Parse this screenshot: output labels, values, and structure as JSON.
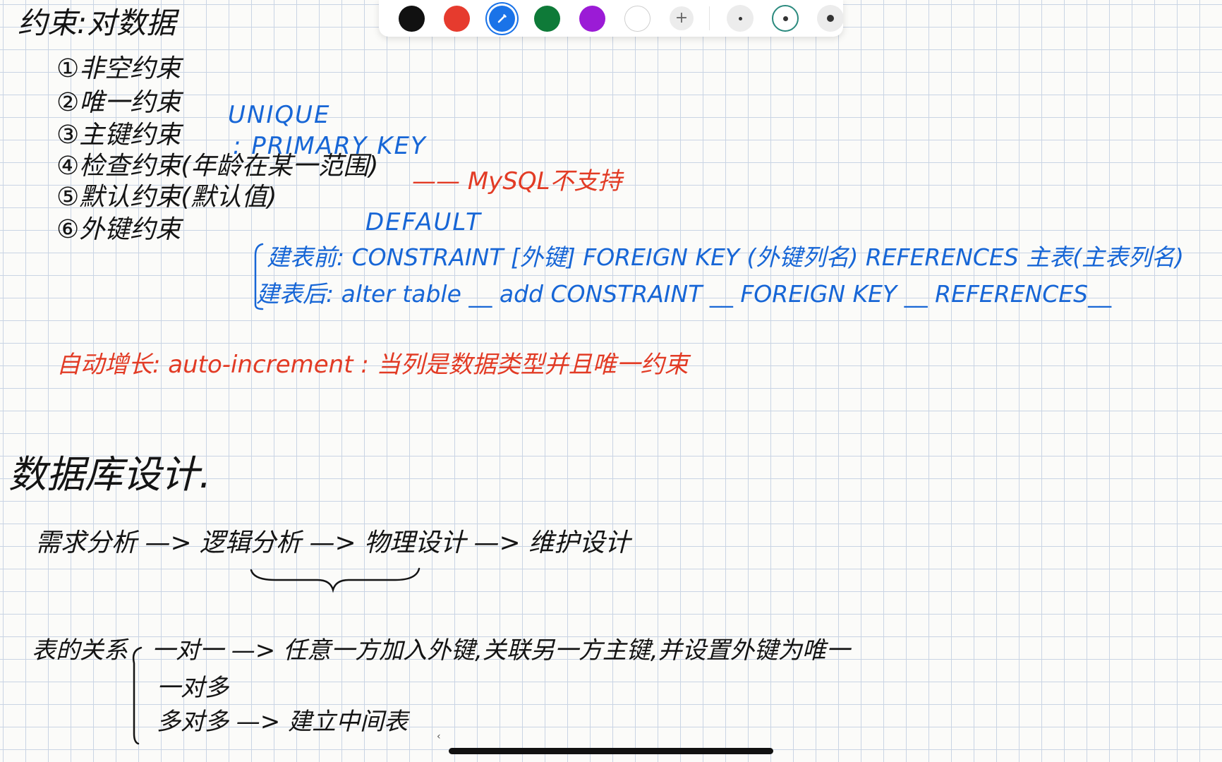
{
  "toolbar": {
    "colors": [
      {
        "name": "black",
        "hex": "#111111"
      },
      {
        "name": "red",
        "hex": "#e63b2e"
      },
      {
        "name": "blue",
        "hex": "#1a73e8",
        "selected": true
      },
      {
        "name": "green",
        "hex": "#0e7a38"
      },
      {
        "name": "purple",
        "hex": "#9b1bd6"
      },
      {
        "name": "white",
        "hex": "#ffffff"
      }
    ],
    "add_label": "+",
    "sizes": [
      "small",
      "medium",
      "large"
    ],
    "selected_size": "medium",
    "pencil_icon": "pencil-icon"
  },
  "notes": {
    "constraints_title": "约束:对数据",
    "constraint_items": [
      "①非空约束",
      "②唯一约束",
      "③主键约束",
      "④检查约束(年龄在某一范围)",
      "⑤默认约束(默认值)",
      "⑥外键约束"
    ],
    "unique_keyword": "UNIQUE",
    "primary_key_keyword": ": PRIMARY KEY",
    "mysql_note": "—— MySQL不支持",
    "default_keyword": "DEFAULT",
    "fk_before": "建表前: CONSTRAINT [外键] FOREIGN KEY (外键列名) REFERENCES 主表(主表列名)",
    "fk_after": "建表后: alter table __ add CONSTRAINT __ FOREIGN KEY __ REFERENCES__",
    "auto_increment": "自动增长: auto-increment : 当列是数据类型并且唯一约束",
    "design_title": "数据库设计.",
    "design_process": "需求分析 —> 逻辑分析 —> 物理设计 —> 维护设计",
    "relations_label": "表的关系",
    "relation_one_to_one": "一对一 —> 任意一方加入外键,关联另一方主键,并设置外键为唯一",
    "relation_one_to_many": "一对多",
    "relation_many_to_many": "多对多 —> 建立中间表"
  },
  "ink_colors": {
    "black": "#141414",
    "blue": "#1766d6",
    "red": "#e23b25"
  }
}
